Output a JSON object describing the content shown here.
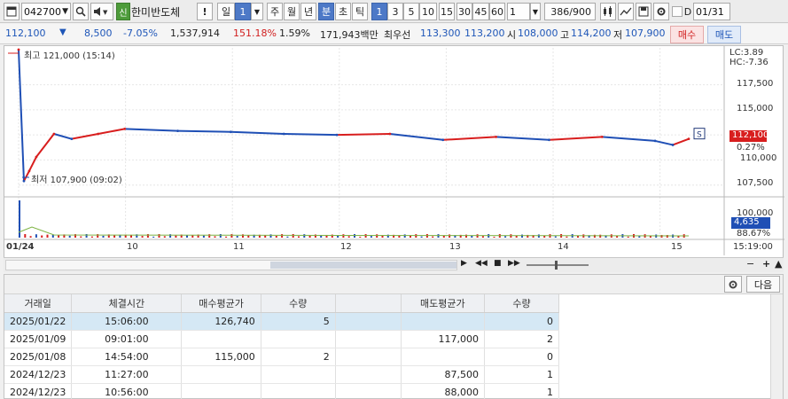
{
  "toolbar": {
    "code": "042700",
    "credit_badge": "신",
    "stock_name": "한미반도체",
    "alert": "!",
    "period_day": "일",
    "period_num": "1",
    "week": "주",
    "month": "월",
    "year": "년",
    "minute": "분",
    "second": "초",
    "tick": "틱",
    "intervals": [
      "1",
      "3",
      "5",
      "10",
      "15",
      "30",
      "45",
      "60"
    ],
    "interval_input": "1",
    "count": "386",
    "count_total": "/900",
    "date_check_label": "D",
    "date_value": "01/31"
  },
  "quote": {
    "price": "112,100",
    "change": "8,500",
    "change_pct": "-7.05%",
    "volume": "1,537,914",
    "volume_ratio": "151.18%",
    "turnover_rate": "1.59%",
    "amount": "171,943백만",
    "best_label": "최우선",
    "best_ask": "113,300",
    "best_bid": "113,200",
    "open_label": "시",
    "open": "108,000",
    "high_label": "고",
    "high": "114,200",
    "low_label": "저",
    "low": "107,900",
    "buy_button": "매수",
    "sell_button": "매도"
  },
  "chart": {
    "high_annotation": "최고 121,000 (15:14)",
    "low_annotation": "최저 107,900 (09:02)",
    "lc": "LC:3.89",
    "hc": "HC:-7.36",
    "price_box": "112,100",
    "price_pct": "0.27%",
    "volume_box": "4,635",
    "volume_pct": "88.67%",
    "s_marker": "S",
    "x_labels": [
      "01/24",
      "10",
      "11",
      "12",
      "13",
      "14",
      "15",
      "15:19:00"
    ],
    "y_labels": [
      "117,500",
      "115,000",
      "110,000",
      "107,500",
      "100,000"
    ],
    "colors": {
      "up": "#d81e1e",
      "down": "#1f4fb5",
      "ma": "#7cb342"
    }
  },
  "chart_data": {
    "type": "line",
    "title": "",
    "xlabel": "",
    "ylabel": "",
    "ylim": [
      106500,
      121000
    ],
    "x": [
      "09:00",
      "09:03",
      "09:06",
      "09:10",
      "09:20",
      "09:30",
      "09:45",
      "10:00",
      "10:30",
      "11:00",
      "11:30",
      "12:00",
      "12:30",
      "13:00",
      "13:30",
      "14:00",
      "14:30",
      "15:00",
      "15:10",
      "15:19"
    ],
    "series": [
      {
        "values": [
          121000,
          107900,
          108900,
          110300,
          112600,
          112100,
          112600,
          113100,
          112900,
          112800,
          112600,
          112500,
          112600,
          112000,
          112300,
          112000,
          112300,
          111900,
          111500,
          112100
        ]
      }
    ]
  },
  "table": {
    "settings_icon": "gear-icon",
    "next_button": "다음",
    "headers": [
      "거래일",
      "체결시간",
      "매수평균가",
      "수량",
      "",
      "매도평균가",
      "수량"
    ],
    "rows": [
      [
        "2025/01/22",
        "15:06:00",
        "126,740",
        "5",
        "",
        "",
        "0"
      ],
      [
        "2025/01/09",
        "09:01:00",
        "",
        "",
        "",
        "117,000",
        "2"
      ],
      [
        "2025/01/08",
        "14:54:00",
        "115,000",
        "2",
        "",
        "",
        "0"
      ],
      [
        "2024/12/23",
        "11:27:00",
        "",
        "",
        "",
        "87,500",
        "1"
      ],
      [
        "2024/12/23",
        "10:56:00",
        "",
        "",
        "",
        "88,000",
        "1"
      ]
    ]
  }
}
